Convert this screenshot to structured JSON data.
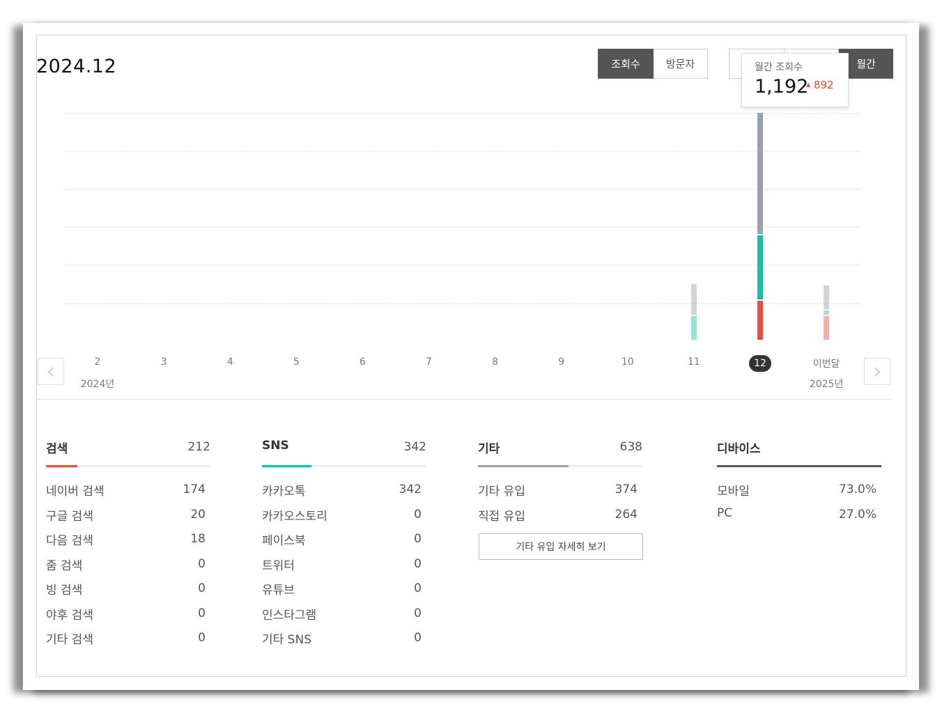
{
  "header": {
    "period": "2024.12"
  },
  "metric_toggle": [
    {
      "label": "조회수",
      "active": true
    },
    {
      "label": "방문자",
      "active": false
    }
  ],
  "range_toggle": [
    {
      "label": "",
      "active": false
    },
    {
      "label": "",
      "active": false
    },
    {
      "label": "월간",
      "active": true
    }
  ],
  "tooltip": {
    "label": "월간 조회수",
    "value": "1,192",
    "delta": "892",
    "delta_color": "#e8493a"
  },
  "colors": {
    "search": "#f04c3c",
    "sns": "#16c0a4",
    "etc": "#9aa1a9",
    "dark": "#555555"
  },
  "chart_data": {
    "type": "bar",
    "stacked": true,
    "categories": [
      "2",
      "3",
      "4",
      "5",
      "6",
      "7",
      "8",
      "9",
      "10",
      "11",
      "12",
      "이번달"
    ],
    "years": {
      "start": "2024년",
      "end": "2025년"
    },
    "selected_index": 10,
    "series": [
      {
        "key": "search",
        "color": "#f04c3c",
        "values": [
          0,
          0,
          0,
          0,
          0,
          0,
          0,
          0,
          0,
          0,
          212,
          130
        ]
      },
      {
        "key": "sns",
        "color": "#16c0a4",
        "values": [
          0,
          0,
          0,
          0,
          0,
          0,
          0,
          0,
          0,
          130,
          342,
          30
        ]
      },
      {
        "key": "etc",
        "color": "#9aa1a9",
        "values": [
          0,
          0,
          0,
          0,
          0,
          0,
          0,
          0,
          0,
          170,
          638,
          130
        ]
      }
    ],
    "ylim": [
      0,
      1200
    ],
    "grid": true,
    "faded_indices": [
      9,
      11
    ]
  },
  "stats": {
    "search": {
      "title": "검색",
      "total": "212",
      "ratio": 0.19,
      "rows": [
        {
          "name": "네이버 검색",
          "value": "174"
        },
        {
          "name": "구글 검색",
          "value": "20"
        },
        {
          "name": "다음 검색",
          "value": "18"
        },
        {
          "name": "줌 검색",
          "value": "0"
        },
        {
          "name": "빙 검색",
          "value": "0"
        },
        {
          "name": "야후 검색",
          "value": "0"
        },
        {
          "name": "기타 검색",
          "value": "0"
        }
      ]
    },
    "sns": {
      "title": "SNS",
      "total": "342",
      "ratio": 0.3,
      "rows": [
        {
          "name": "카카오톡",
          "value": "342"
        },
        {
          "name": "카카오스토리",
          "value": "0"
        },
        {
          "name": "페이스북",
          "value": "0"
        },
        {
          "name": "트위터",
          "value": "0"
        },
        {
          "name": "유튜브",
          "value": "0"
        },
        {
          "name": "인스타그램",
          "value": "0"
        },
        {
          "name": "기타 SNS",
          "value": "0"
        }
      ]
    },
    "etc": {
      "title": "기타",
      "total": "638",
      "ratio": 0.55,
      "rows": [
        {
          "name": "기타 유입",
          "value": "374"
        },
        {
          "name": "직접 유입",
          "value": "264"
        }
      ],
      "detail_button": "기타 유입 자세히 보기"
    },
    "device": {
      "title": "디바이스",
      "total": "",
      "ratio": 1.0,
      "rows": [
        {
          "name": "모바일",
          "value": "73.0%"
        },
        {
          "name": "PC",
          "value": "27.0%"
        }
      ]
    }
  },
  "icons": {
    "prev": "chevron-left-icon",
    "next": "chevron-right-icon"
  }
}
